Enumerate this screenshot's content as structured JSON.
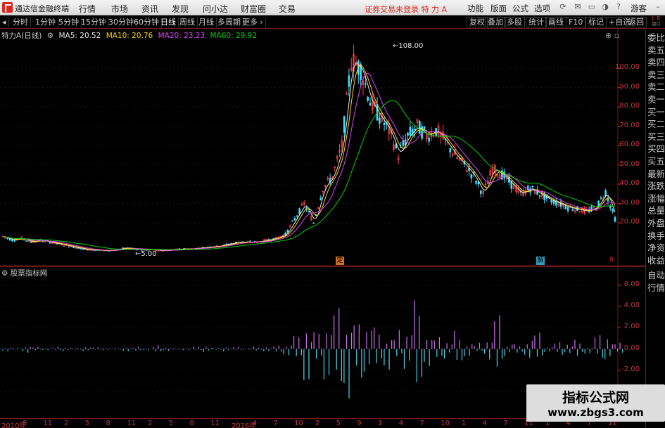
{
  "window": {
    "app_title": "通达信金融终端",
    "menus": [
      "行情",
      "市场",
      "资讯",
      "发现",
      "问小达",
      "财富圈",
      "交易"
    ],
    "notice": "证券交易未登录",
    "stock_name": "特 力 A",
    "right_menus": [
      "功能",
      "版面",
      "公式",
      "选项"
    ],
    "guest": "游客"
  },
  "toolbar": {
    "periods": [
      "分时",
      "1分钟",
      "5分钟",
      "15分钟",
      "30分钟",
      "60分钟",
      "日线",
      "周线",
      "月线",
      "多周期",
      "更多"
    ],
    "active_period": "日线",
    "tools": [
      "复权",
      "叠加",
      "多股",
      "统计",
      "画线",
      "F10",
      "标记",
      "+自选",
      "返回"
    ],
    "corner_top": "L R",
    "corner_bottom": "盘口"
  },
  "legend": {
    "stock": "特力A(日线)",
    "ma5": "MA5: 20.52",
    "ma10": "MA10: 20.76",
    "ma20": "MA20: 23.23",
    "ma60": "MA60: 29.92"
  },
  "colors": {
    "ma5": "#e6e6e6",
    "ma10": "#ffd400",
    "ma20": "#e040fb",
    "ma60": "#00d000",
    "up": "#ff4040",
    "down": "#40e0ff",
    "axis": "#c8363c"
  },
  "main_annotations": {
    "high_label": "108.00",
    "low_label": "5.00",
    "markers": [
      "定",
      "解",
      "8"
    ]
  },
  "right_panel": [
    "委比",
    "卖五",
    "卖四",
    "卖三",
    "卖二",
    "卖一",
    "买一",
    "买二",
    "买三",
    "买四",
    "买五",
    "最新",
    "涨跌",
    "涨幅",
    "总量",
    "外盘",
    "换手",
    "净资",
    "收益",
    "自动",
    "行情"
  ],
  "volume": {
    "legend": "股票指标网"
  },
  "chart_data": [
    {
      "type": "line",
      "title": "特力A(日线)",
      "x_labels": [
        "2010年",
        "8",
        "11",
        "2",
        "5",
        "8",
        "11",
        "2",
        "5",
        "8",
        "11",
        "2016年",
        "4",
        "7",
        "10",
        "2",
        "5",
        "9",
        "1",
        "4",
        "7",
        "10",
        "1",
        "4",
        "7",
        "11",
        "1",
        "4",
        "7",
        "11"
      ],
      "ylim": [
        4,
        115
      ],
      "y_ticks": [
        20,
        30,
        40,
        50,
        60,
        70,
        80,
        90,
        100
      ],
      "series": [
        {
          "name": "Close",
          "values": [
            13,
            11,
            12,
            10,
            11,
            10,
            9,
            8,
            7,
            6,
            6,
            5.5,
            6,
            7,
            6.5,
            6,
            6,
            5.5,
            6,
            6.5,
            6.5,
            7,
            7.5,
            8,
            9,
            10,
            10,
            10,
            11,
            12,
            14,
            22,
            30,
            20,
            38,
            44,
            60,
            104,
            100,
            83,
            75,
            68,
            55,
            65,
            70,
            65,
            68,
            62,
            55,
            50,
            44,
            35,
            48,
            45,
            40,
            35,
            38,
            35,
            32,
            30,
            28,
            27,
            26,
            28,
            36,
            22
          ]
        }
      ]
    },
    {
      "type": "bar",
      "title": "股票指标网",
      "ylim": [
        -6,
        7
      ],
      "y_ticks": [
        -4,
        -2,
        0,
        2,
        4,
        6
      ],
      "series": [
        {
          "name": "Indicator",
          "values": [
            -0.2,
            0.1,
            -0.3,
            0.2,
            -0.1,
            0.2,
            -0.2,
            0.1,
            -0.3,
            0.2,
            -0.1,
            0.1,
            -0.2,
            0.2,
            -0.1,
            0.3,
            -0.2,
            0.1,
            -0.1,
            0.2,
            -0.3,
            0.1,
            -0.2,
            0.2,
            -0.1,
            0.2,
            -0.2,
            0.4,
            -0.6,
            1.2,
            -2.5,
            2.2,
            -4.5,
            6.8,
            -5.2,
            5.5,
            -3.5,
            2,
            -1.8,
            1.5,
            -2.2,
            5,
            -1.5,
            1.2,
            -0.8,
            1.5,
            -0.7,
            0.6,
            -1,
            3.6,
            -0.7,
            0.5,
            -1.2,
            1.6,
            -0.5,
            0.8,
            -0.6,
            1,
            -0.4,
            1.6,
            -1.4,
            0.6
          ]
        }
      ]
    }
  ]
}
